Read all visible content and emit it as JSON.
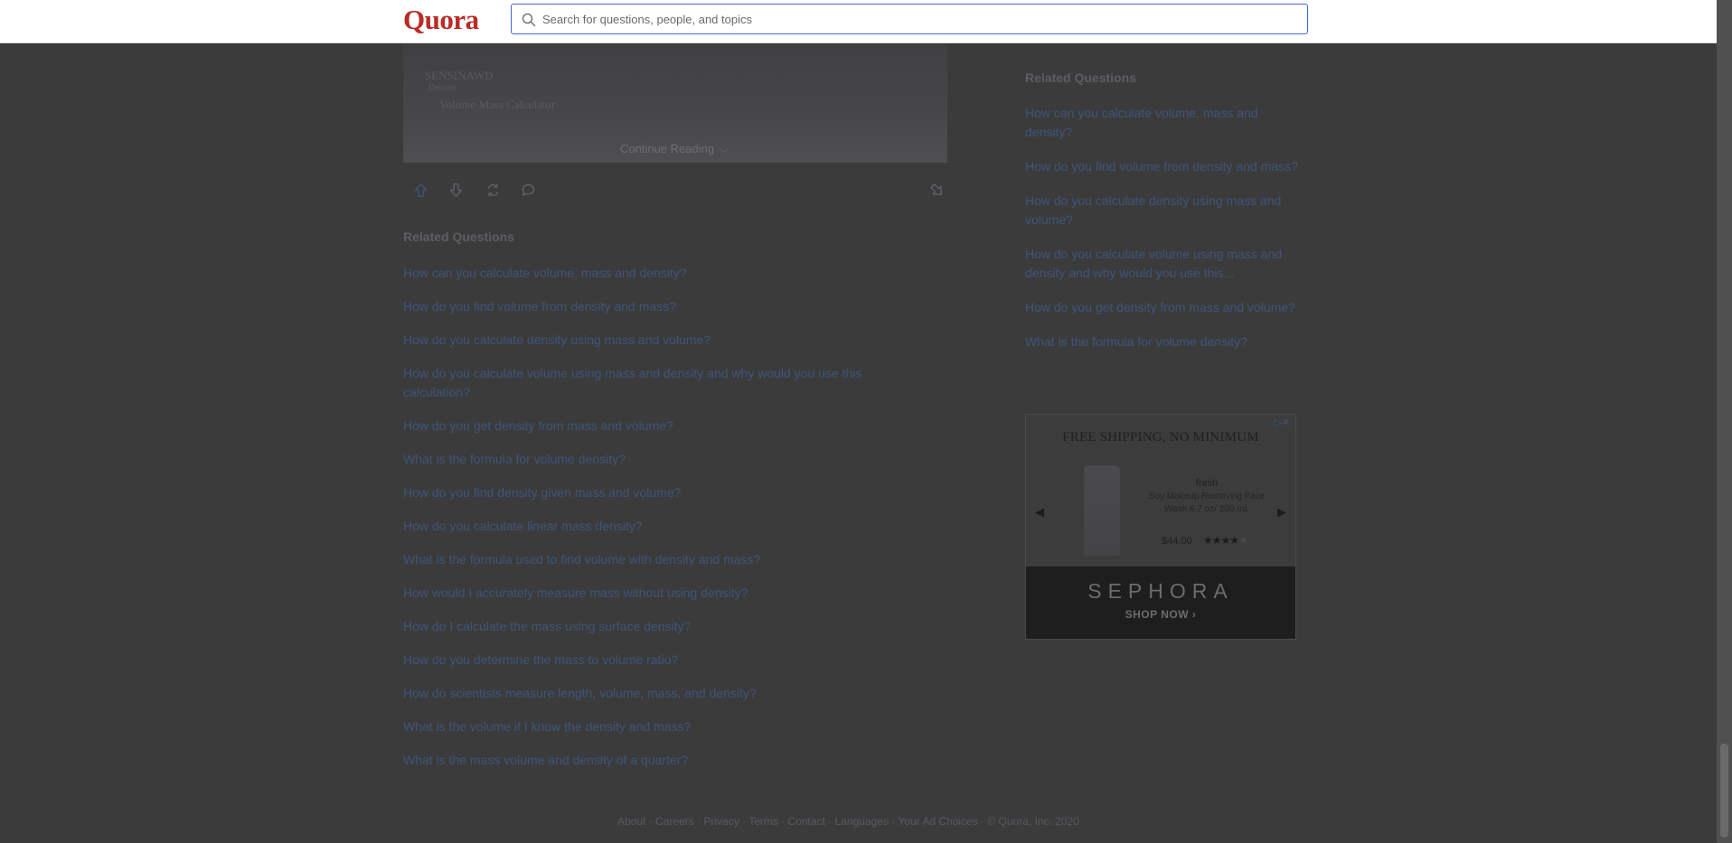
{
  "header": {
    "logo": "Quora",
    "search_placeholder": "Search for questions, people, and topics"
  },
  "answer": {
    "continue_reading": "Continue Reading",
    "image_scrawl": [
      "SENSINAWD",
      "Density",
      "Volume  Mass  Calculator"
    ]
  },
  "related_main": {
    "heading": "Related Questions",
    "items": [
      "How can you calculate volume, mass and density?",
      "How do you find volume from density and mass?",
      "How do you calculate density using mass and volume?",
      "How do you calculate volume using mass and density and why would you use this calculation?",
      "How do you get density from mass and volume?",
      "What is the formula for volume density?",
      "How do you find density given mass and volume?",
      "How do you calculate linear mass density?",
      "What is the formula used to find volume with density and mass?",
      "How would I accurately measure mass without using density?",
      "How do I calculate the mass using surface density?",
      "How do you determine the mass to volume ratio?",
      "How do scientists measure length, volume, mass, and density?",
      "What is the volume if I know the density and mass?",
      "What is the mass volume and density of a quarter?"
    ]
  },
  "related_side": {
    "heading": "Related Questions",
    "items": [
      "How can you calculate volume, mass and density?",
      "How do you find volume from density and mass?",
      "How do you calculate density using mass and volume?",
      "How do you calculate volume using mass and density and why would you use this...",
      "How do you get density from mass and volume?",
      "What is the formula for volume density?"
    ]
  },
  "ad": {
    "headline": "FREE SHIPPING, NO MINIMUM",
    "adchoices_glyph": "▷✕",
    "brand": "fresh",
    "product_name": "Soy Makeup Removing Face Wash 6.7 oz/ 200 mL",
    "price": "$44.00",
    "rating": 4,
    "rating_max": 5,
    "logo": "SEPHORA",
    "cta": "SHOP NOW ›"
  },
  "footer": {
    "links": [
      "About",
      "Careers",
      "Privacy",
      "Terms",
      "Contact",
      "Languages",
      "Your Ad Choices"
    ],
    "copyright": "© Quora, Inc. 2020"
  },
  "colors": {
    "brand": "#b92b27",
    "search_border": "#3f6ad8",
    "overlay_bg": "#3b3b3c",
    "link": "#3e5579"
  }
}
